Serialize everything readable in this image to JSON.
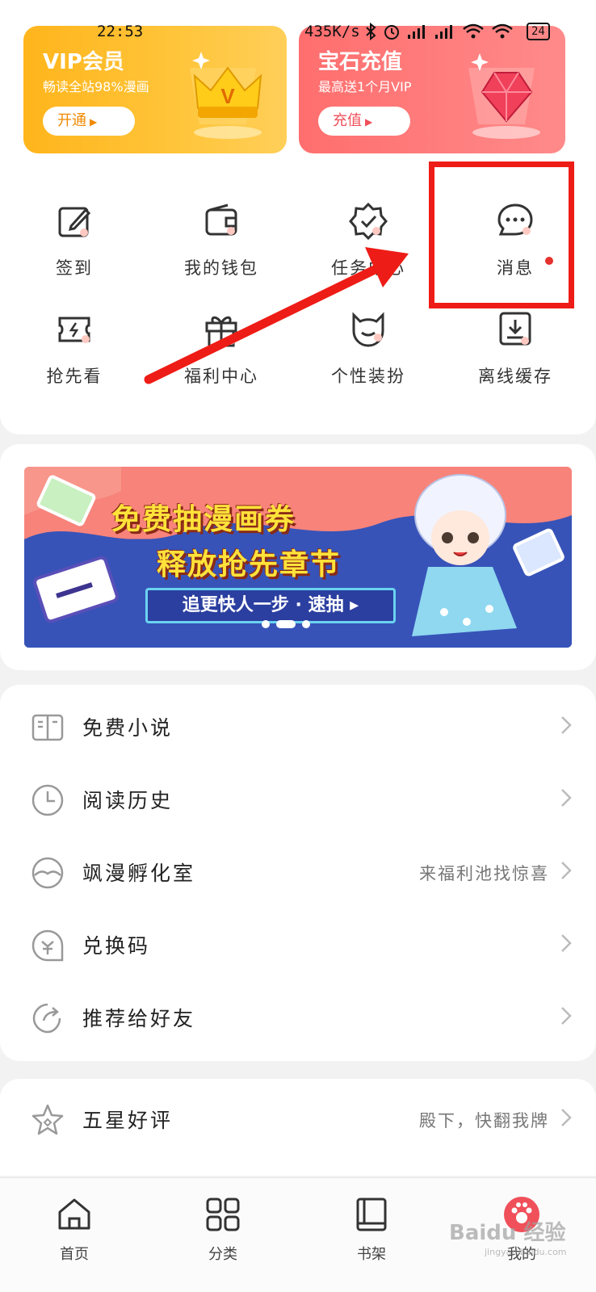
{
  "status_bar": {
    "time": "22:53",
    "net_speed": "435K/s",
    "battery": "24"
  },
  "promo": {
    "vip": {
      "title": "VIP会员",
      "subtitle": "畅读全站98%漫画",
      "button": "开通"
    },
    "gem": {
      "title": "宝石充值",
      "subtitle": "最高送1个月VIP",
      "button": "充值"
    }
  },
  "grid": [
    {
      "label": "签到",
      "icon": "edit-icon"
    },
    {
      "label": "我的钱包",
      "icon": "wallet-icon"
    },
    {
      "label": "任务中心",
      "icon": "badge-check-icon"
    },
    {
      "label": "消息",
      "icon": "chat-bubble-icon",
      "has_dot": true
    },
    {
      "label": "抢先看",
      "icon": "ticket-icon"
    },
    {
      "label": "福利中心",
      "icon": "gift-icon"
    },
    {
      "label": "个性装扮",
      "icon": "cat-face-icon"
    },
    {
      "label": "离线缓存",
      "icon": "download-icon"
    }
  ],
  "banner": {
    "line1": "免费抽漫画券",
    "line2": "释放抢先章节",
    "cta": "追更快人一步 · 速抽 ▸"
  },
  "menu": [
    {
      "label": "免费小说",
      "icon": "book-open-icon",
      "right_text": ""
    },
    {
      "label": "阅读历史",
      "icon": "clock-icon",
      "right_text": ""
    },
    {
      "label": "飒漫孵化室",
      "icon": "bowl-icon",
      "right_text": "来福利池找惊喜"
    },
    {
      "label": "兑换码",
      "icon": "coupon-icon",
      "right_text": ""
    },
    {
      "label": "推荐给好友",
      "icon": "share-icon",
      "right_text": ""
    }
  ],
  "rate": {
    "label": "五星好评",
    "icon": "star-icon",
    "right_text": "殿下，快翻我牌"
  },
  "bottom_nav": [
    {
      "label": "首页",
      "icon": "home-icon"
    },
    {
      "label": "分类",
      "icon": "grid-icon"
    },
    {
      "label": "书架",
      "icon": "bookshelf-icon"
    },
    {
      "label": "我的",
      "icon": "avatar-icon",
      "active": true
    }
  ],
  "watermark": {
    "text": "Baidu 经验",
    "sub": "jingyan.baidu.com"
  },
  "colors": {
    "accent_red": "#ee1c16",
    "vip_orange": "#ffb51c",
    "gem_pink": "#ff6e6e",
    "banner_blue": "#2f4fb2"
  }
}
